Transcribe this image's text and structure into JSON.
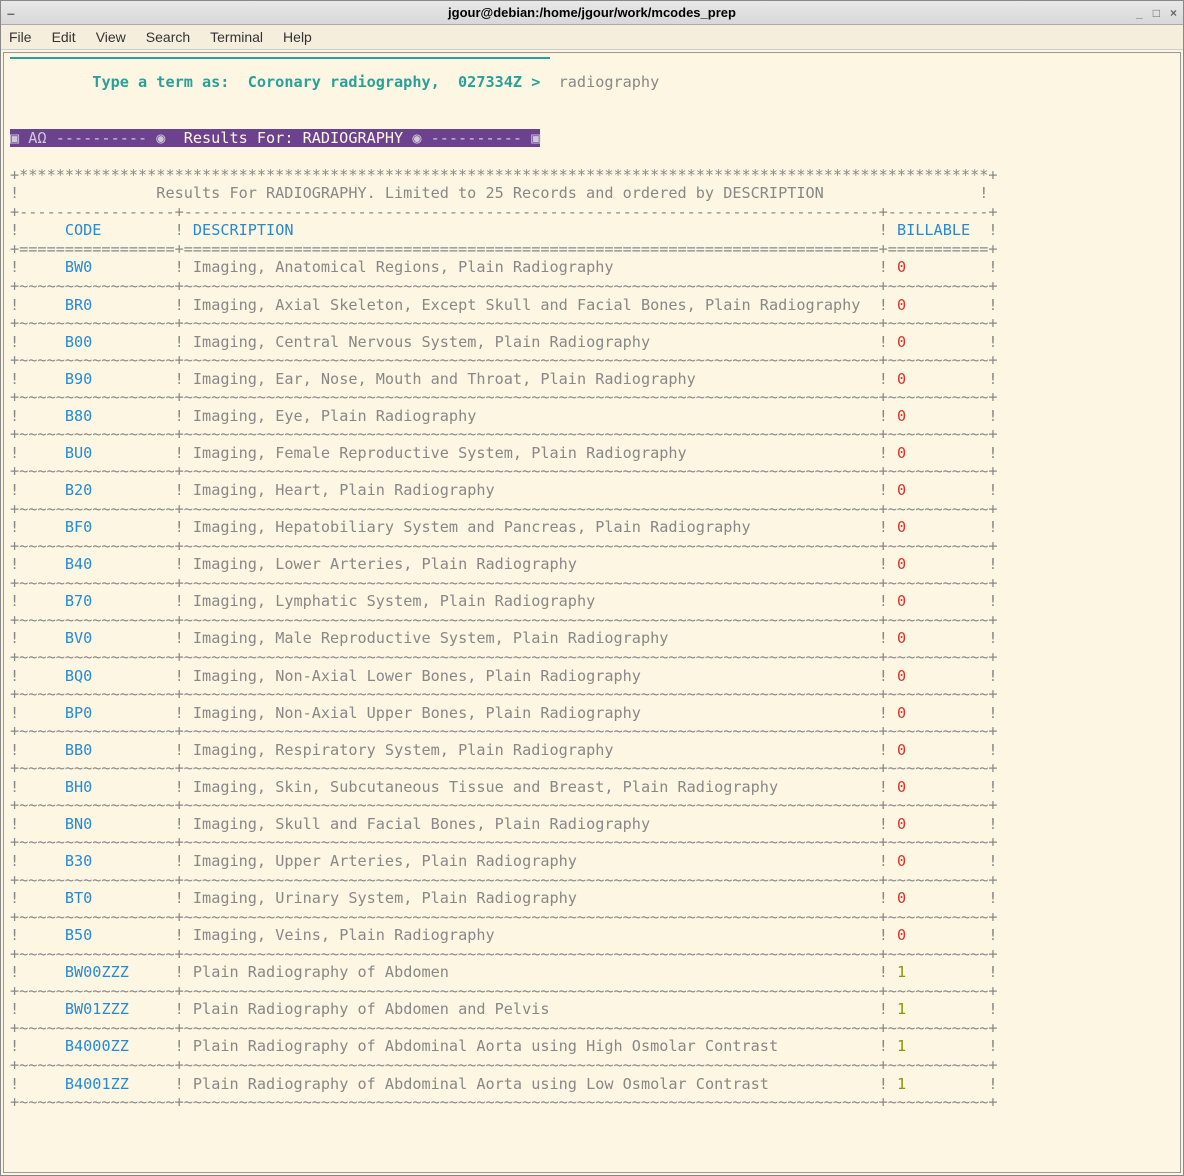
{
  "titlebar": {
    "title": "jgour@debian:/home/jgour/work/mcodes_prep"
  },
  "menubar": {
    "file": "File",
    "edit": "Edit",
    "view": "View",
    "search": "Search",
    "terminal": "Terminal",
    "help": "Help"
  },
  "prompt": {
    "label": "Type a term as:  Coronary radiography,  027334Z >",
    "input": "radiography"
  },
  "results_banner": {
    "prefix": "▣ ΑΩ ---------- ◉  ",
    "label": "Results For: RADIOGRAPHY",
    "suffix": " ◉ ---------- ▣"
  },
  "results_header": "Results For RADIOGRAPHY. Limited to 25 Records and ordered by DESCRIPTION",
  "columns": {
    "code": "CODE",
    "description": "DESCRIPTION",
    "billable": "BILLABLE"
  },
  "rows": [
    {
      "code": "BW0",
      "desc": "Imaging, Anatomical Regions, Plain Radiography",
      "bill": "0"
    },
    {
      "code": "BR0",
      "desc": "Imaging, Axial Skeleton, Except Skull and Facial Bones, Plain Radiography",
      "bill": "0"
    },
    {
      "code": "B00",
      "desc": "Imaging, Central Nervous System, Plain Radiography",
      "bill": "0"
    },
    {
      "code": "B90",
      "desc": "Imaging, Ear, Nose, Mouth and Throat, Plain Radiography",
      "bill": "0"
    },
    {
      "code": "B80",
      "desc": "Imaging, Eye, Plain Radiography",
      "bill": "0"
    },
    {
      "code": "BU0",
      "desc": "Imaging, Female Reproductive System, Plain Radiography",
      "bill": "0"
    },
    {
      "code": "B20",
      "desc": "Imaging, Heart, Plain Radiography",
      "bill": "0"
    },
    {
      "code": "BF0",
      "desc": "Imaging, Hepatobiliary System and Pancreas, Plain Radiography",
      "bill": "0"
    },
    {
      "code": "B40",
      "desc": "Imaging, Lower Arteries, Plain Radiography",
      "bill": "0"
    },
    {
      "code": "B70",
      "desc": "Imaging, Lymphatic System, Plain Radiography",
      "bill": "0"
    },
    {
      "code": "BV0",
      "desc": "Imaging, Male Reproductive System, Plain Radiography",
      "bill": "0"
    },
    {
      "code": "BQ0",
      "desc": "Imaging, Non-Axial Lower Bones, Plain Radiography",
      "bill": "0"
    },
    {
      "code": "BP0",
      "desc": "Imaging, Non-Axial Upper Bones, Plain Radiography",
      "bill": "0"
    },
    {
      "code": "BB0",
      "desc": "Imaging, Respiratory System, Plain Radiography",
      "bill": "0"
    },
    {
      "code": "BH0",
      "desc": "Imaging, Skin, Subcutaneous Tissue and Breast, Plain Radiography",
      "bill": "0"
    },
    {
      "code": "BN0",
      "desc": "Imaging, Skull and Facial Bones, Plain Radiography",
      "bill": "0"
    },
    {
      "code": "B30",
      "desc": "Imaging, Upper Arteries, Plain Radiography",
      "bill": "0"
    },
    {
      "code": "BT0",
      "desc": "Imaging, Urinary System, Plain Radiography",
      "bill": "0"
    },
    {
      "code": "B50",
      "desc": "Imaging, Veins, Plain Radiography",
      "bill": "0"
    },
    {
      "code": "BW00ZZZ",
      "desc": "Plain Radiography of Abdomen",
      "bill": "1"
    },
    {
      "code": "BW01ZZZ",
      "desc": "Plain Radiography of Abdomen and Pelvis",
      "bill": "1"
    },
    {
      "code": "B4000ZZ",
      "desc": "Plain Radiography of Abdominal Aorta using High Osmolar Contrast",
      "bill": "1"
    },
    {
      "code": "B4001ZZ",
      "desc": "Plain Radiography of Abdominal Aorta using Low Osmolar Contrast",
      "bill": "1"
    }
  ],
  "divider_major": "+-----------------+----------------------------------------------------------------------------+-----------+",
  "divider_top": "+**********************************************************************************************************+",
  "divider_eq": "+=================+============================================================================+===========+",
  "divider_tilde": "+~~~~~~~~~~~~~~~~~+~~~~~~~~~~~~~~~~~~~~~~~~~~~~~~~~~~~~~~~~~~~~~~~~~~~~~~~~~~~~~~~~~~~~~~~~~~~~+~~~~~~~~~~~+"
}
